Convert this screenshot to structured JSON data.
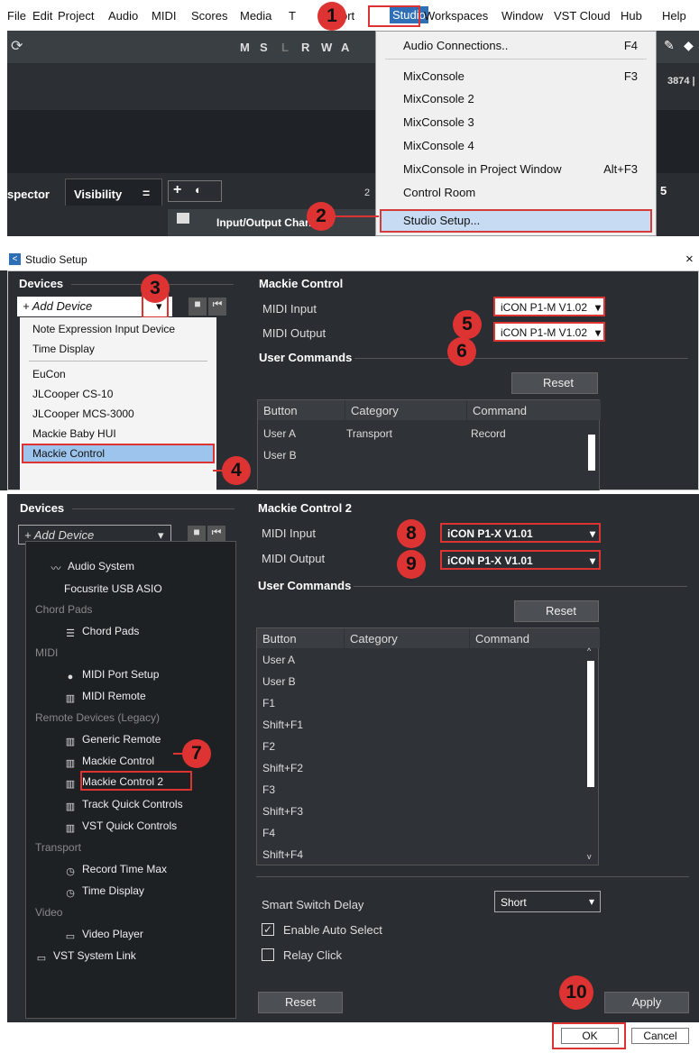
{
  "menu_bar": {
    "items": [
      "File",
      "Edit",
      "Project",
      "Audio",
      "MIDI",
      "Scores",
      "Media",
      "T",
      "ort",
      "Studio",
      "Workspaces",
      "Window",
      "VST Cloud",
      "Hub",
      "Help"
    ]
  },
  "daw": {
    "transport_letters": [
      "M",
      "S",
      "L",
      "R",
      "W",
      "A"
    ],
    "counter": "3874 |",
    "inspector_tab": "spector",
    "visibility_tab": "Visibility",
    "eq_glyph": "=",
    "io_channels": "Input/Output Channels",
    "track_num_a": "2",
    "track_num_b": "5"
  },
  "studio_menu": {
    "items": [
      {
        "label": "Audio Connections..",
        "shortcut": "F4"
      },
      {
        "label": "MixConsole",
        "shortcut": "F3"
      },
      {
        "label": "MixConsole 2",
        "shortcut": ""
      },
      {
        "label": "MixConsole 3",
        "shortcut": ""
      },
      {
        "label": "MixConsole 4",
        "shortcut": ""
      },
      {
        "label": "MixConsole in Project Window",
        "shortcut": "Alt+F3"
      },
      {
        "label": "Control Room",
        "shortcut": ""
      },
      {
        "label": "Studio Setup...",
        "shortcut": ""
      }
    ]
  },
  "studio_setup": {
    "window_title": "Studio Setup",
    "close_glyph": "×",
    "devices_heading": "Devices",
    "add_device": "+ Add Device",
    "device_dropdown": [
      "Note Expression Input Device",
      "Time Display",
      "EuCon",
      "JLCooper CS-10",
      "JLCooper MCS-3000",
      "Mackie Baby HUI",
      "Mackie Control"
    ],
    "panel1": {
      "heading": "Mackie Control",
      "midi_input_label": "MIDI Input",
      "midi_output_label": "MIDI Output",
      "midi_input_value": "iCON P1-M V1.02",
      "midi_output_value": "iCON P1-M V1.02",
      "user_commands": "User Commands",
      "reset": "Reset",
      "columns": [
        "Button",
        "Category",
        "Command"
      ],
      "rows": [
        {
          "button": "User A",
          "category": "Transport",
          "command": "Record"
        },
        {
          "button": "User B",
          "category": "",
          "command": ""
        }
      ]
    },
    "panel2": {
      "heading": "Mackie Control 2",
      "midi_input_label": "MIDI Input",
      "midi_output_label": "MIDI Output",
      "midi_input_value": "iCON P1-X V1.01",
      "midi_output_value": "iCON P1-X V1.01",
      "user_commands": "User Commands",
      "reset": "Reset",
      "columns": [
        "Button",
        "Category",
        "Command"
      ],
      "rows": [
        "User A",
        "User B",
        "F1",
        "Shift+F1",
        "F2",
        "Shift+F2",
        "F3",
        "Shift+F3",
        "F4",
        "Shift+F4"
      ],
      "smart_switch_label": "Smart Switch Delay",
      "smart_switch_value": "Short",
      "enable_auto_select": "Enable Auto Select",
      "relay_click": "Relay Click",
      "reset_bottom": "Reset",
      "apply": "Apply",
      "ok": "OK",
      "cancel": "Cancel"
    },
    "tree": [
      {
        "label": "Audio System",
        "type": "item",
        "icon": "waveform-icon",
        "indent": 1
      },
      {
        "label": "Focusrite USB ASIO",
        "type": "item",
        "icon": "",
        "indent": 2
      },
      {
        "label": "Chord Pads",
        "type": "category",
        "indent": 0
      },
      {
        "label": "Chord Pads",
        "type": "item",
        "icon": "chord-pads-icon",
        "indent": 1
      },
      {
        "label": "MIDI",
        "type": "category",
        "indent": 0
      },
      {
        "label": "MIDI Port Setup",
        "type": "item",
        "icon": "midi-port-icon",
        "indent": 1
      },
      {
        "label": "MIDI Remote",
        "type": "item",
        "icon": "keyboard-icon",
        "indent": 1
      },
      {
        "label": "Remote Devices (Legacy)",
        "type": "category",
        "indent": 0
      },
      {
        "label": "Generic Remote",
        "type": "item",
        "icon": "keyboard-icon",
        "indent": 1
      },
      {
        "label": "Mackie Control",
        "type": "item",
        "icon": "keyboard-icon",
        "indent": 1
      },
      {
        "label": "Mackie Control 2",
        "type": "item",
        "icon": "keyboard-icon",
        "indent": 1
      },
      {
        "label": "Track Quick Controls",
        "type": "item",
        "icon": "keyboard-icon",
        "indent": 1
      },
      {
        "label": "VST Quick Controls",
        "type": "item",
        "icon": "keyboard-icon",
        "indent": 1
      },
      {
        "label": "Transport",
        "type": "category",
        "indent": 0
      },
      {
        "label": "Record Time Max",
        "type": "item",
        "icon": "clock-icon",
        "indent": 1
      },
      {
        "label": "Time Display",
        "type": "item",
        "icon": "clock-icon",
        "indent": 1
      },
      {
        "label": "Video",
        "type": "category",
        "indent": 0
      },
      {
        "label": "Video Player",
        "type": "item",
        "icon": "video-icon",
        "indent": 1
      },
      {
        "label": "VST System Link",
        "type": "item",
        "icon": "monitor-icon",
        "indent": 0
      }
    ]
  },
  "step_badges": [
    "1",
    "2",
    "3",
    "4",
    "5",
    "6",
    "7",
    "8",
    "9",
    "10"
  ],
  "colors": {
    "accent_red": "#d33333",
    "selection_blue": "#c7dcf2",
    "dark_bg": "#2a2d31"
  }
}
